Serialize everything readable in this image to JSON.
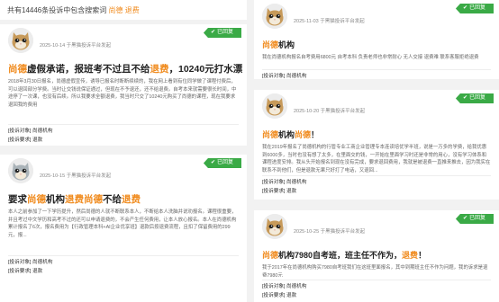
{
  "summary": {
    "prefix": "共有",
    "count": "14446",
    "suffix": "条投诉中包含搜索词",
    "keyword": "尚德 退费"
  },
  "labels": {
    "target_label": "[投诉对象]",
    "request_label": "[投诉要求]"
  },
  "colors": {
    "accent": "#f08a1c",
    "badge": "#3aaa46"
  },
  "complaints": [
    {
      "avatar": "cat-avatar-tan",
      "date": "2025-10-14",
      "source": "于黑猫投诉平台发起",
      "status": "已回复",
      "title_parts": [
        "",
        "尚德",
        "虚假承诺，报班考不过且不给",
        "退费",
        "，10240元打水漂"
      ],
      "body": "2018年3月30日报名，尚德虚假宣传，诱导已报名时断断续续的，我在网上看到有位同学做了课程付费后，可以退回部分学费。当时让交钱说保证通过，但现在不予退还，还不给退费。自考本来就需要很长时间，中途停了一次课，也没有后续。所以我要求全额退费，我当时只交了10240元购买了尚德的课程，现在我要求退回我的费用",
      "target": "尚德机构",
      "request": "退款"
    },
    {
      "avatar": "cat-avatar-grey",
      "date": "2025-10-15",
      "source": "于黑猫投诉平台发起",
      "status": "已回复",
      "title_parts": [
        "要求",
        "尚德",
        "机构",
        "退费",
        "",
        "尚德",
        "不给",
        "退费",
        ""
      ],
      "body": "本人之前参加了一下学历提升，然后尚德的人就不断联系本人，不断给本人洗脑并说劝报名。课程很重要，并且考过中文学历和高考不过的还可以申请退费的，不会产生任何费用，让本人放心报名。本人在尚德机构累计报名了6次，报名费用为【行政管理本科+AI企业优享班】退款后按退费流程，且扣了保留费用的299元，报...",
      "target": "尚德机构",
      "request": "退款"
    },
    {
      "avatar": "cat-avatar-tan",
      "date": "2025-11-03",
      "source": "于黑猫投诉平台发起",
      "status": "已回复",
      "title_parts": [
        "",
        "尚德",
        "机构"
      ],
      "body": "我在尚德机构报名自考费用6800元 自考本科 负责老师也非常耐心 无人交接 退费难 联系客服拒绝退费",
      "target": "尚德机构",
      "request": "退款"
    },
    {
      "avatar": "cat-avatar-tan",
      "date": "2025-10-20",
      "source": "于黑猫投诉平台发起",
      "status": "已回复",
      "title_parts": [
        "",
        "尚德",
        "机构",
        "尚德",
        "！"
      ],
      "body": "我在2019年报名了尚德机构的行管专业工商企业管理专本连读培优学半班，说是一万多的学费，给我优惠到6000多，当时也没有想了太多，在里面交的钱，一开始在里面学习时还是非常的用心，没有学习体系和课程进度安排。我从头开始报名到现在没有完成，要求退回费用，我就是被退费一直推来推去，因为我实在联系不到他们，但是退款无果只好打了电话，又退回...",
      "target": "尚德机构",
      "request": "退款"
    },
    {
      "avatar": "cat-avatar-tan",
      "date": "2025-10-25",
      "source": "于黑猫投诉平台发起",
      "status": "已回复",
      "title_parts": [
        "",
        "尚德",
        "机构7980自考班，班主任不作为，",
        "退费",
        "！"
      ],
      "body": "我于2017年在尚德机构购买7980自考班我们在这班里面报名，其中到期班主任不作为问题，我的诉求是退费7980元",
      "target": "尚德机构",
      "request": "退款"
    }
  ]
}
